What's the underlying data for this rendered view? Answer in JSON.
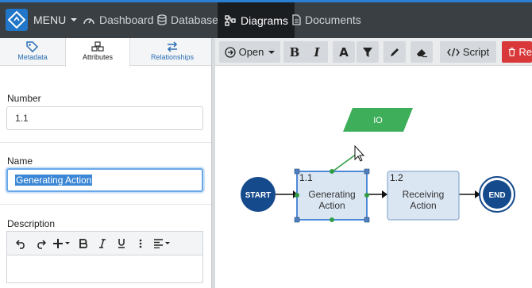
{
  "topbar": {
    "menu_label": "MENU",
    "nav": [
      {
        "label": "Dashboard",
        "icon": "dashboard-icon"
      },
      {
        "label": "Database",
        "icon": "database-icon"
      },
      {
        "label": "Diagrams",
        "icon": "diagram-icon",
        "active": true
      },
      {
        "label": "Documents",
        "icon": "document-icon"
      }
    ],
    "accent_color": "#2a7fd4"
  },
  "left_panel": {
    "tabs": [
      {
        "label": "Metadata",
        "icon": "tag-icon"
      },
      {
        "label": "Attributes",
        "icon": "cubes-icon",
        "active": true
      },
      {
        "label": "Relationships",
        "icon": "swap-icon"
      }
    ],
    "number": {
      "label": "Number",
      "value": "1.1"
    },
    "name": {
      "label": "Name",
      "value": "Generating Action"
    },
    "description": {
      "label": "Description"
    }
  },
  "diagram_toolbar": {
    "open_label": "Open",
    "bold_label": "B",
    "italic_label": "I",
    "font_label": "A",
    "script_label": "Script",
    "red_label": "Re"
  },
  "diagram": {
    "io_label": "IO",
    "start_label": "START",
    "end_label": "END",
    "action1": {
      "number": "1.1",
      "line1": "Generating",
      "line2": "Action"
    },
    "action2": {
      "number": "1.2",
      "line1": "Receiving",
      "line2": "Action"
    },
    "colors": {
      "io_fill": "#3fae5b",
      "node_fill": "#154a8c",
      "selection": "#2b6fd0"
    }
  }
}
